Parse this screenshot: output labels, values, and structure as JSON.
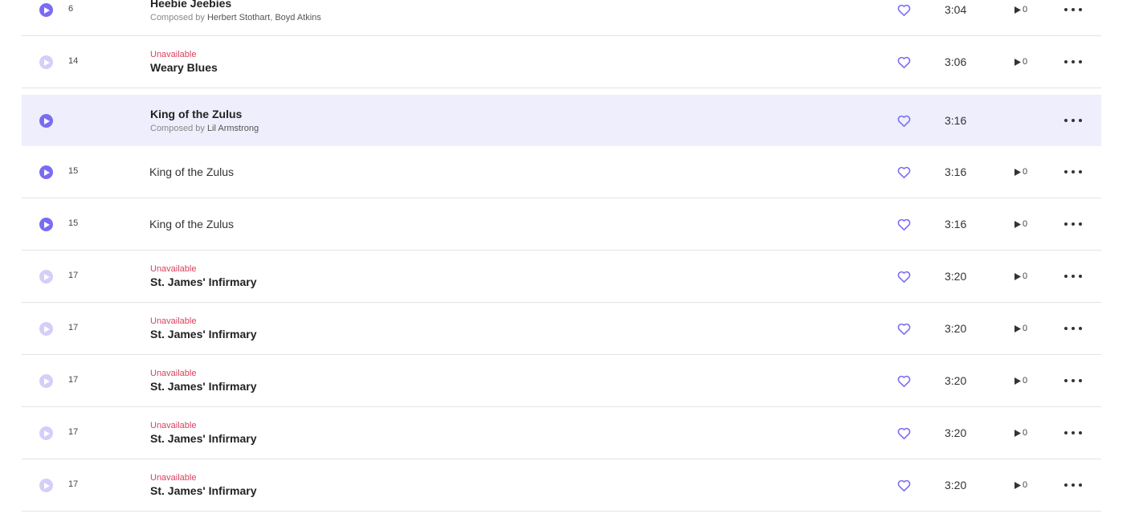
{
  "labels": {
    "unavailable": "Unavailable",
    "composed_by": "Composed by "
  },
  "colors": {
    "accent": "#7a6cf2",
    "accent_disabled": "#d4cff8",
    "unavailable": "#d9415d",
    "highlight_bg": "#eeeefc"
  },
  "tracks": [
    {
      "number": "6",
      "title": "Heebie Jeebies",
      "composers": [
        "Herbert Stothart",
        ", ",
        "Boyd Atkins"
      ],
      "duration": "3:04",
      "plays": "0",
      "available": true
    },
    {
      "number": "14",
      "title": "Weary Blues",
      "duration": "3:06",
      "plays": "0",
      "available": false
    },
    {
      "number": "",
      "title": "King of the Zulus",
      "composers": [
        "Lil Armstrong"
      ],
      "duration": "3:16",
      "plays": "",
      "available": true,
      "highlighted": true
    },
    {
      "number": "15",
      "title": "King of the Zulus",
      "duration": "3:16",
      "plays": "0",
      "available": true
    },
    {
      "number": "15",
      "title": "King of the Zulus",
      "duration": "3:16",
      "plays": "0",
      "available": true
    },
    {
      "number": "17",
      "title": "St. James' Infirmary",
      "duration": "3:20",
      "plays": "0",
      "available": false
    },
    {
      "number": "17",
      "title": "St. James' Infirmary",
      "duration": "3:20",
      "plays": "0",
      "available": false
    },
    {
      "number": "17",
      "title": "St. James' Infirmary",
      "duration": "3:20",
      "plays": "0",
      "available": false
    },
    {
      "number": "17",
      "title": "St. James' Infirmary",
      "duration": "3:20",
      "plays": "0",
      "available": false
    },
    {
      "number": "17",
      "title": "St. James' Infirmary",
      "duration": "3:20",
      "plays": "0",
      "available": false
    }
  ]
}
